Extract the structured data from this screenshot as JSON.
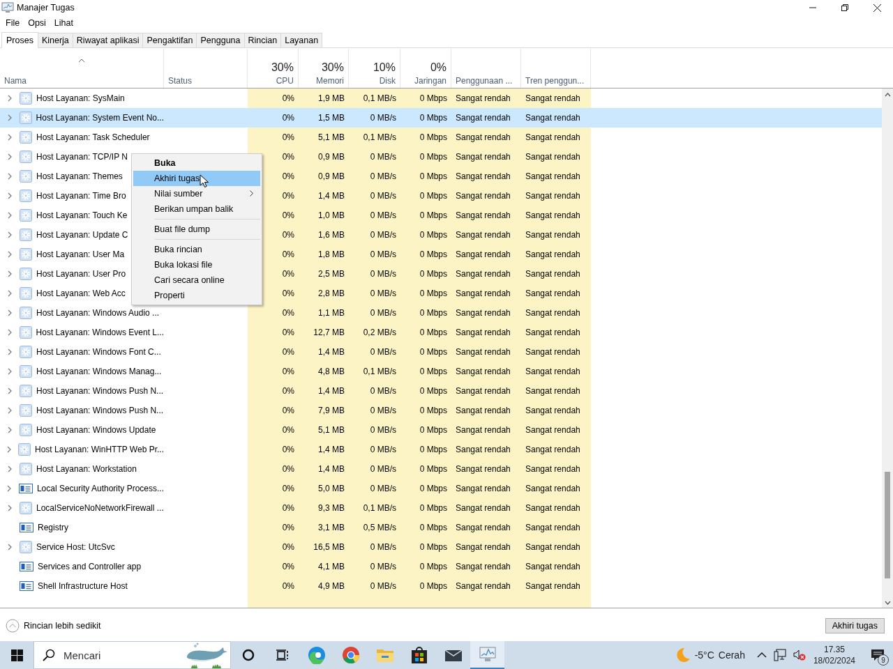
{
  "window": {
    "title": "Manajer Tugas"
  },
  "menu": [
    "File",
    "Opsi",
    "Lihat"
  ],
  "tabs": [
    {
      "label": "Proses",
      "selected": true
    },
    {
      "label": "Kinerja",
      "selected": false
    },
    {
      "label": "Riwayat aplikasi",
      "selected": false
    },
    {
      "label": "Pengaktifan",
      "selected": false
    },
    {
      "label": "Pengguna",
      "selected": false
    },
    {
      "label": "Rincian",
      "selected": false
    },
    {
      "label": "Layanan",
      "selected": false
    }
  ],
  "table": {
    "columns": [
      {
        "label": "Nama",
        "sorted": true
      },
      {
        "label": "Status",
        "sorted": false
      },
      {
        "percent": "30%",
        "label": "CPU",
        "sorted": false
      },
      {
        "percent": "30%",
        "label": "Memori",
        "sorted": false
      },
      {
        "percent": "10%",
        "label": "Disk",
        "sorted": false
      },
      {
        "percent": "0%",
        "label": "Jaringan",
        "sorted": false
      },
      {
        "label": "Penggunaan ...",
        "sorted": false
      },
      {
        "label": "Tren penggun...",
        "sorted": false
      }
    ],
    "rows": [
      {
        "name": "Host Layanan: SysMain",
        "kind": "service",
        "expandable": true,
        "selected": false,
        "cpu": "0%",
        "memory": "1,9 MB",
        "disk": "0,1 MB/s",
        "network": "0 Mbps",
        "power": "Sangat rendah",
        "power_trend": "Sangat rendah"
      },
      {
        "name": "Host Layanan: System Event No...",
        "kind": "service",
        "expandable": true,
        "selected": true,
        "cpu": "0%",
        "memory": "1,5 MB",
        "disk": "0 MB/s",
        "network": "0 Mbps",
        "power": "Sangat rendah",
        "power_trend": "Sangat rendah"
      },
      {
        "name": "Host Layanan: Task Scheduler",
        "kind": "service",
        "expandable": true,
        "selected": false,
        "cpu": "0%",
        "memory": "5,1 MB",
        "disk": "0,1 MB/s",
        "network": "0 Mbps",
        "power": "Sangat rendah",
        "power_trend": "Sangat rendah"
      },
      {
        "name": "Host Layanan: TCP/IP N",
        "kind": "service",
        "expandable": true,
        "selected": false,
        "cpu": "0%",
        "memory": "0,9 MB",
        "disk": "0 MB/s",
        "network": "0 Mbps",
        "power": "Sangat rendah",
        "power_trend": "Sangat rendah"
      },
      {
        "name": "Host Layanan: Themes",
        "kind": "service",
        "expandable": true,
        "selected": false,
        "cpu": "0%",
        "memory": "0,9 MB",
        "disk": "0 MB/s",
        "network": "0 Mbps",
        "power": "Sangat rendah",
        "power_trend": "Sangat rendah"
      },
      {
        "name": "Host Layanan: Time Bro",
        "kind": "service",
        "expandable": true,
        "selected": false,
        "cpu": "0%",
        "memory": "1,4 MB",
        "disk": "0 MB/s",
        "network": "0 Mbps",
        "power": "Sangat rendah",
        "power_trend": "Sangat rendah"
      },
      {
        "name": "Host Layanan: Touch Ke",
        "kind": "service",
        "expandable": true,
        "selected": false,
        "cpu": "0%",
        "memory": "1,0 MB",
        "disk": "0 MB/s",
        "network": "0 Mbps",
        "power": "Sangat rendah",
        "power_trend": "Sangat rendah"
      },
      {
        "name": "Host Layanan: Update C",
        "kind": "service",
        "expandable": true,
        "selected": false,
        "cpu": "0%",
        "memory": "1,6 MB",
        "disk": "0 MB/s",
        "network": "0 Mbps",
        "power": "Sangat rendah",
        "power_trend": "Sangat rendah"
      },
      {
        "name": "Host Layanan: User Ma",
        "kind": "service",
        "expandable": true,
        "selected": false,
        "cpu": "0%",
        "memory": "1,8 MB",
        "disk": "0 MB/s",
        "network": "0 Mbps",
        "power": "Sangat rendah",
        "power_trend": "Sangat rendah"
      },
      {
        "name": "Host Layanan: User Pro",
        "kind": "service",
        "expandable": true,
        "selected": false,
        "cpu": "0%",
        "memory": "2,5 MB",
        "disk": "0 MB/s",
        "network": "0 Mbps",
        "power": "Sangat rendah",
        "power_trend": "Sangat rendah"
      },
      {
        "name": "Host Layanan: Web Acc",
        "kind": "service",
        "expandable": true,
        "selected": false,
        "cpu": "0%",
        "memory": "2,8 MB",
        "disk": "0 MB/s",
        "network": "0 Mbps",
        "power": "Sangat rendah",
        "power_trend": "Sangat rendah"
      },
      {
        "name": "Host Layanan: Windows Audio ...",
        "kind": "service",
        "expandable": true,
        "selected": false,
        "cpu": "0%",
        "memory": "1,1 MB",
        "disk": "0 MB/s",
        "network": "0 Mbps",
        "power": "Sangat rendah",
        "power_trend": "Sangat rendah"
      },
      {
        "name": "Host Layanan: Windows Event L...",
        "kind": "service",
        "expandable": true,
        "selected": false,
        "cpu": "0%",
        "memory": "12,7 MB",
        "disk": "0,2 MB/s",
        "network": "0 Mbps",
        "power": "Sangat rendah",
        "power_trend": "Sangat rendah"
      },
      {
        "name": "Host Layanan: Windows Font C...",
        "kind": "service",
        "expandable": true,
        "selected": false,
        "cpu": "0%",
        "memory": "1,4 MB",
        "disk": "0 MB/s",
        "network": "0 Mbps",
        "power": "Sangat rendah",
        "power_trend": "Sangat rendah"
      },
      {
        "name": "Host Layanan: Windows Manag...",
        "kind": "service",
        "expandable": true,
        "selected": false,
        "cpu": "0%",
        "memory": "4,8 MB",
        "disk": "0,1 MB/s",
        "network": "0 Mbps",
        "power": "Sangat rendah",
        "power_trend": "Sangat rendah"
      },
      {
        "name": "Host Layanan: Windows Push N...",
        "kind": "service",
        "expandable": true,
        "selected": false,
        "cpu": "0%",
        "memory": "1,4 MB",
        "disk": "0 MB/s",
        "network": "0 Mbps",
        "power": "Sangat rendah",
        "power_trend": "Sangat rendah"
      },
      {
        "name": "Host Layanan: Windows Push N...",
        "kind": "service",
        "expandable": true,
        "selected": false,
        "cpu": "0%",
        "memory": "7,9 MB",
        "disk": "0 MB/s",
        "network": "0 Mbps",
        "power": "Sangat rendah",
        "power_trend": "Sangat rendah"
      },
      {
        "name": "Host Layanan: Windows Update",
        "kind": "service",
        "expandable": true,
        "selected": false,
        "cpu": "0%",
        "memory": "5,1 MB",
        "disk": "0 MB/s",
        "network": "0 Mbps",
        "power": "Sangat rendah",
        "power_trend": "Sangat rendah"
      },
      {
        "name": "Host Layanan: WinHTTP Web Pr...",
        "kind": "service",
        "expandable": true,
        "selected": false,
        "cpu": "0%",
        "memory": "1,4 MB",
        "disk": "0 MB/s",
        "network": "0 Mbps",
        "power": "Sangat rendah",
        "power_trend": "Sangat rendah"
      },
      {
        "name": "Host Layanan: Workstation",
        "kind": "service",
        "expandable": true,
        "selected": false,
        "cpu": "0%",
        "memory": "1,4 MB",
        "disk": "0 MB/s",
        "network": "0 Mbps",
        "power": "Sangat rendah",
        "power_trend": "Sangat rendah"
      },
      {
        "name": "Local Security Authority Process...",
        "kind": "app",
        "expandable": true,
        "selected": false,
        "cpu": "0%",
        "memory": "5,0 MB",
        "disk": "0 MB/s",
        "network": "0 Mbps",
        "power": "Sangat rendah",
        "power_trend": "Sangat rendah"
      },
      {
        "name": "LocalServiceNoNetworkFirewall ...",
        "kind": "service",
        "expandable": true,
        "selected": false,
        "cpu": "0%",
        "memory": "9,3 MB",
        "disk": "0,1 MB/s",
        "network": "0 Mbps",
        "power": "Sangat rendah",
        "power_trend": "Sangat rendah"
      },
      {
        "name": "Registry",
        "kind": "app",
        "expandable": false,
        "selected": false,
        "cpu": "0%",
        "memory": "3,1 MB",
        "disk": "0,5 MB/s",
        "network": "0 Mbps",
        "power": "Sangat rendah",
        "power_trend": "Sangat rendah"
      },
      {
        "name": "Service Host: UtcSvc",
        "kind": "service",
        "expandable": true,
        "selected": false,
        "cpu": "0%",
        "memory": "16,5 MB",
        "disk": "0 MB/s",
        "network": "0 Mbps",
        "power": "Sangat rendah",
        "power_trend": "Sangat rendah"
      },
      {
        "name": "Services and Controller app",
        "kind": "app",
        "expandable": false,
        "selected": false,
        "cpu": "0%",
        "memory": "4,1 MB",
        "disk": "0 MB/s",
        "network": "0 Mbps",
        "power": "Sangat rendah",
        "power_trend": "Sangat rendah"
      },
      {
        "name": "Shell Infrastructure Host",
        "kind": "app",
        "expandable": false,
        "selected": false,
        "cpu": "0%",
        "memory": "4,9 MB",
        "disk": "0 MB/s",
        "network": "0 Mbps",
        "power": "Sangat rendah",
        "power_trend": "Sangat rendah"
      }
    ]
  },
  "context_menu": {
    "items": [
      {
        "kind": "item",
        "label": "Buka",
        "default": true,
        "selected": false,
        "submenu": false
      },
      {
        "kind": "item",
        "label": "Akhiri tugas",
        "default": false,
        "selected": true,
        "submenu": false
      },
      {
        "kind": "item",
        "label": "Nilai sumber",
        "default": false,
        "selected": false,
        "submenu": true
      },
      {
        "kind": "item",
        "label": "Berikan umpan balik",
        "default": false,
        "selected": false,
        "submenu": false
      },
      {
        "kind": "separator"
      },
      {
        "kind": "item",
        "label": "Buat file dump",
        "default": false,
        "selected": false,
        "submenu": false
      },
      {
        "kind": "separator"
      },
      {
        "kind": "item",
        "label": "Buka rincian",
        "default": false,
        "selected": false,
        "submenu": false
      },
      {
        "kind": "item",
        "label": "Buka lokasi file",
        "default": false,
        "selected": false,
        "submenu": false
      },
      {
        "kind": "item",
        "label": "Cari secara online",
        "default": false,
        "selected": false,
        "submenu": false
      },
      {
        "kind": "item",
        "label": "Properti",
        "default": false,
        "selected": false,
        "submenu": false
      }
    ]
  },
  "footer": {
    "fewer_details": "Rincian lebih sedikit",
    "end_task_button": "Akhiri tugas"
  },
  "taskbar": {
    "search": {
      "placeholder": "Mencari"
    },
    "apps": [
      {
        "kind": "cortana",
        "active": false
      },
      {
        "kind": "taskview",
        "active": false
      },
      {
        "kind": "edge",
        "active": false
      },
      {
        "kind": "chrome",
        "active": false
      },
      {
        "kind": "explorer",
        "active": false
      },
      {
        "kind": "store",
        "active": false
      },
      {
        "kind": "mail",
        "active": false
      },
      {
        "kind": "taskmanager",
        "active": true
      }
    ],
    "weather": {
      "temperature": "-5°C",
      "condition": "Cerah"
    },
    "clock": {
      "time": "17.35",
      "date": "18/02/2024"
    },
    "notifications": {
      "count": "9"
    }
  }
}
